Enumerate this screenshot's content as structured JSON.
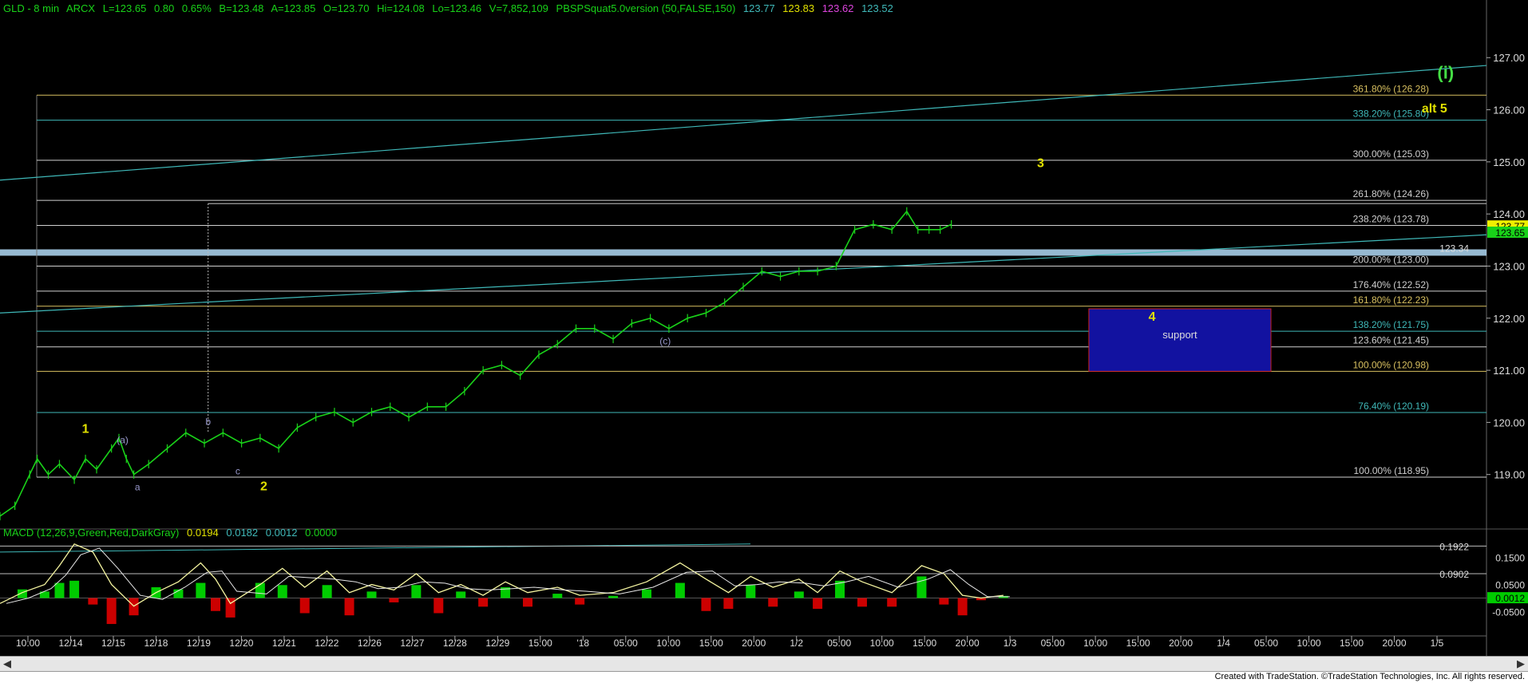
{
  "header": {
    "symbol": "GLD - 8 min",
    "exchange": "ARCX",
    "last": "L=123.65",
    "change": "0.80",
    "change_pct": "0.65%",
    "bid": "B=123.48",
    "ask": "A=123.85",
    "open": "O=123.70",
    "high": "Hi=124.08",
    "low": "Lo=123.46",
    "volume": "V=7,852,109",
    "indicator": "PBSPSquat5.0version (50,FALSE,150)",
    "ind_v1": "123.77",
    "ind_v2": "123.83",
    "ind_v3": "123.62",
    "ind_v4": "123.52"
  },
  "macd_header": {
    "label": "MACD (12,26,9,Green,Red,DarkGray)",
    "v1": "0.0194",
    "v2": "0.0182",
    "v3": "0.0012",
    "v4": "0.0000"
  },
  "colors": {
    "price": "#19d219",
    "fib_line": "#cfcfcf",
    "trend": "#3fb8b8",
    "wave_yellow": "#e0e000",
    "wave_green": "#44dd44",
    "support_box": "#1212a0",
    "support_border": "#cc2222",
    "band": "#a6cde8",
    "macd_up": "#00cc00",
    "macd_down": "#cc0000",
    "macd_line": "#f5f5a0"
  },
  "chart_data": {
    "type": "line",
    "title": "GLD - 8 min",
    "ylim": [
      118.0,
      127.8
    ],
    "yticks": [
      "127.00",
      "126.00",
      "125.00",
      "124.00",
      "123.00",
      "122.00",
      "121.00",
      "120.00",
      "119.00"
    ],
    "ytick_values": [
      127,
      126,
      125,
      124,
      123,
      122,
      121,
      120,
      119
    ],
    "xticks": [
      "10:00",
      "12/14",
      "12/15",
      "12/18",
      "12/19",
      "12/20",
      "12/21",
      "12/22",
      "12/26",
      "12/27",
      "12/28",
      "12/29",
      "15:00",
      "'18",
      "05:00",
      "10:00",
      "15:00",
      "20:00",
      "1/2",
      "05:00",
      "10:00",
      "15:00",
      "20:00",
      "1/3",
      "05:00",
      "10:00",
      "15:00",
      "20:00",
      "1/4",
      "05:00",
      "10:00",
      "15:00",
      "20:00",
      "1/5"
    ],
    "price_path": [
      [
        0.0,
        118.2
      ],
      [
        0.4,
        118.4
      ],
      [
        0.8,
        119.0
      ],
      [
        1.0,
        119.3
      ],
      [
        1.3,
        119.0
      ],
      [
        1.6,
        119.2
      ],
      [
        2.0,
        118.9
      ],
      [
        2.3,
        119.3
      ],
      [
        2.6,
        119.1
      ],
      [
        3.0,
        119.5
      ],
      [
        3.2,
        119.7
      ],
      [
        3.4,
        119.3
      ],
      [
        3.6,
        119.0
      ],
      [
        4.0,
        119.2
      ],
      [
        4.5,
        119.5
      ],
      [
        5.0,
        119.8
      ],
      [
        5.5,
        119.6
      ],
      [
        6.0,
        119.8
      ],
      [
        6.5,
        119.6
      ],
      [
        7.0,
        119.7
      ],
      [
        7.5,
        119.5
      ],
      [
        8.0,
        119.9
      ],
      [
        8.5,
        120.1
      ],
      [
        9.0,
        120.2
      ],
      [
        9.5,
        120.0
      ],
      [
        10.0,
        120.2
      ],
      [
        10.5,
        120.3
      ],
      [
        11.0,
        120.1
      ],
      [
        11.5,
        120.3
      ],
      [
        12.0,
        120.3
      ],
      [
        12.5,
        120.6
      ],
      [
        13.0,
        121.0
      ],
      [
        13.5,
        121.1
      ],
      [
        14.0,
        120.9
      ],
      [
        14.5,
        121.3
      ],
      [
        15.0,
        121.5
      ],
      [
        15.5,
        121.8
      ],
      [
        16.0,
        121.8
      ],
      [
        16.5,
        121.6
      ],
      [
        17.0,
        121.9
      ],
      [
        17.5,
        122.0
      ],
      [
        18.0,
        121.8
      ],
      [
        18.5,
        122.0
      ],
      [
        19.0,
        122.1
      ],
      [
        19.5,
        122.3
      ],
      [
        20.0,
        122.6
      ],
      [
        20.5,
        122.9
      ],
      [
        21.0,
        122.8
      ],
      [
        21.5,
        122.9
      ],
      [
        22.0,
        122.9
      ],
      [
        22.5,
        123.0
      ],
      [
        23.0,
        123.7
      ],
      [
        23.5,
        123.8
      ],
      [
        24.0,
        123.7
      ],
      [
        24.4,
        124.05
      ],
      [
        24.7,
        123.7
      ],
      [
        25.0,
        123.7
      ],
      [
        25.3,
        123.7
      ],
      [
        25.6,
        123.8
      ]
    ],
    "fib_levels": [
      {
        "label": "361.80% (126.28)",
        "value": 126.28,
        "color": "#d8c060"
      },
      {
        "label": "338.20% (125.80)",
        "value": 125.8,
        "color": "#3fb8b8"
      },
      {
        "label": "300.00% (125.03)",
        "value": 125.03,
        "color": "#cfcfcf"
      },
      {
        "label": "261.80% (124.26)",
        "value": 124.26,
        "color": "#cfcfcf"
      },
      {
        "label": "238.20% (123.78)",
        "value": 123.78,
        "color": "#cfcfcf"
      },
      {
        "label": "200.00% (123.00)",
        "value": 123.0,
        "color": "#cfcfcf"
      },
      {
        "label": "176.40% (122.52)",
        "value": 122.52,
        "color": "#cfcfcf"
      },
      {
        "label": "161.80% (122.23)",
        "value": 122.23,
        "color": "#d8c060"
      },
      {
        "label": "138.20% (121.75)",
        "value": 121.75,
        "color": "#3fb8b8"
      },
      {
        "label": "123.60% (121.45)",
        "value": 121.45,
        "color": "#cfcfcf"
      },
      {
        "label": "100.00% (120.98)",
        "value": 120.98,
        "color": "#d8c060"
      },
      {
        "label": "76.40% (120.19)",
        "value": 120.19,
        "color": "#3fb8b8"
      },
      {
        "label": "100.00% (118.95)",
        "value": 118.95,
        "color": "#cfcfcf"
      }
    ],
    "price_labels": [
      {
        "text": "123.34",
        "value": 123.34
      }
    ],
    "last_price_tags": [
      {
        "text": "123.77",
        "value": 123.77,
        "bg": "#f0f000"
      },
      {
        "text": "123.65",
        "value": 123.65,
        "bg": "#19d219"
      }
    ],
    "wave_labels": [
      {
        "text": "1",
        "x": 2.3,
        "y": 119.8,
        "color": "#e0e000"
      },
      {
        "text": "2",
        "x": 7.1,
        "y": 118.7,
        "color": "#e0e000"
      },
      {
        "text": "3",
        "x": 28.0,
        "y": 124.9,
        "color": "#e0e000"
      },
      {
        "text": "4",
        "x": 31.0,
        "y": 121.95,
        "color": "#e0e000"
      },
      {
        "text": "alt 5",
        "x": 38.6,
        "y": 125.95,
        "color": "#e0e000"
      },
      {
        "text": "(i)",
        "x": 38.9,
        "y": 126.6,
        "color": "#44dd44"
      },
      {
        "text": "(a)",
        "x": 3.3,
        "y": 119.6,
        "color": "#9999cc"
      },
      {
        "text": "a",
        "x": 3.7,
        "y": 118.7,
        "color": "#9999cc"
      },
      {
        "text": "b",
        "x": 5.6,
        "y": 119.95,
        "color": "#9999cc"
      },
      {
        "text": "c",
        "x": 6.4,
        "y": 119.0,
        "color": "#9999cc"
      },
      {
        "text": "(c)",
        "x": 17.9,
        "y": 121.5,
        "color": "#9999cc"
      }
    ],
    "support_box": {
      "label": "support",
      "x0": 29.3,
      "x1": 34.2,
      "y0": 120.98,
      "y1": 122.18
    },
    "macd": {
      "ylim": [
        -0.09,
        0.22
      ],
      "ticks": [
        "0.1922",
        "0.1500",
        "0.0902",
        "0.0500",
        "0.0012",
        "-0.0500"
      ],
      "tick_values": [
        0.1922,
        0.15,
        0.0902,
        0.05,
        0.0012,
        -0.05
      ],
      "line": [
        [
          0.0,
          -0.02
        ],
        [
          0.6,
          0.02
        ],
        [
          1.2,
          0.05
        ],
        [
          1.6,
          0.12
        ],
        [
          2.0,
          0.2
        ],
        [
          2.5,
          0.17
        ],
        [
          3.0,
          0.05
        ],
        [
          3.6,
          -0.03
        ],
        [
          4.2,
          0.02
        ],
        [
          4.8,
          0.06
        ],
        [
          5.4,
          0.13
        ],
        [
          5.8,
          0.07
        ],
        [
          6.2,
          -0.02
        ],
        [
          7.0,
          0.05
        ],
        [
          7.6,
          0.11
        ],
        [
          8.2,
          0.04
        ],
        [
          8.8,
          0.1
        ],
        [
          9.4,
          0.02
        ],
        [
          10.0,
          0.05
        ],
        [
          10.6,
          0.03
        ],
        [
          11.2,
          0.09
        ],
        [
          11.8,
          0.02
        ],
        [
          12.4,
          0.05
        ],
        [
          13.0,
          0.01
        ],
        [
          13.6,
          0.06
        ],
        [
          14.2,
          0.02
        ],
        [
          15.0,
          0.04
        ],
        [
          15.6,
          0.01
        ],
        [
          16.5,
          0.02
        ],
        [
          17.4,
          0.06
        ],
        [
          18.3,
          0.13
        ],
        [
          19.0,
          0.07
        ],
        [
          19.6,
          0.02
        ],
        [
          20.2,
          0.08
        ],
        [
          20.8,
          0.04
        ],
        [
          21.5,
          0.07
        ],
        [
          22.0,
          0.02
        ],
        [
          22.6,
          0.1
        ],
        [
          23.2,
          0.06
        ],
        [
          24.0,
          0.02
        ],
        [
          24.8,
          0.12
        ],
        [
          25.4,
          0.09
        ],
        [
          25.9,
          0.01
        ],
        [
          26.4,
          0.0
        ],
        [
          27.0,
          0.01
        ]
      ]
    }
  },
  "footer": "Created with TradeStation. ©TradeStation Technologies, Inc. All rights reserved."
}
